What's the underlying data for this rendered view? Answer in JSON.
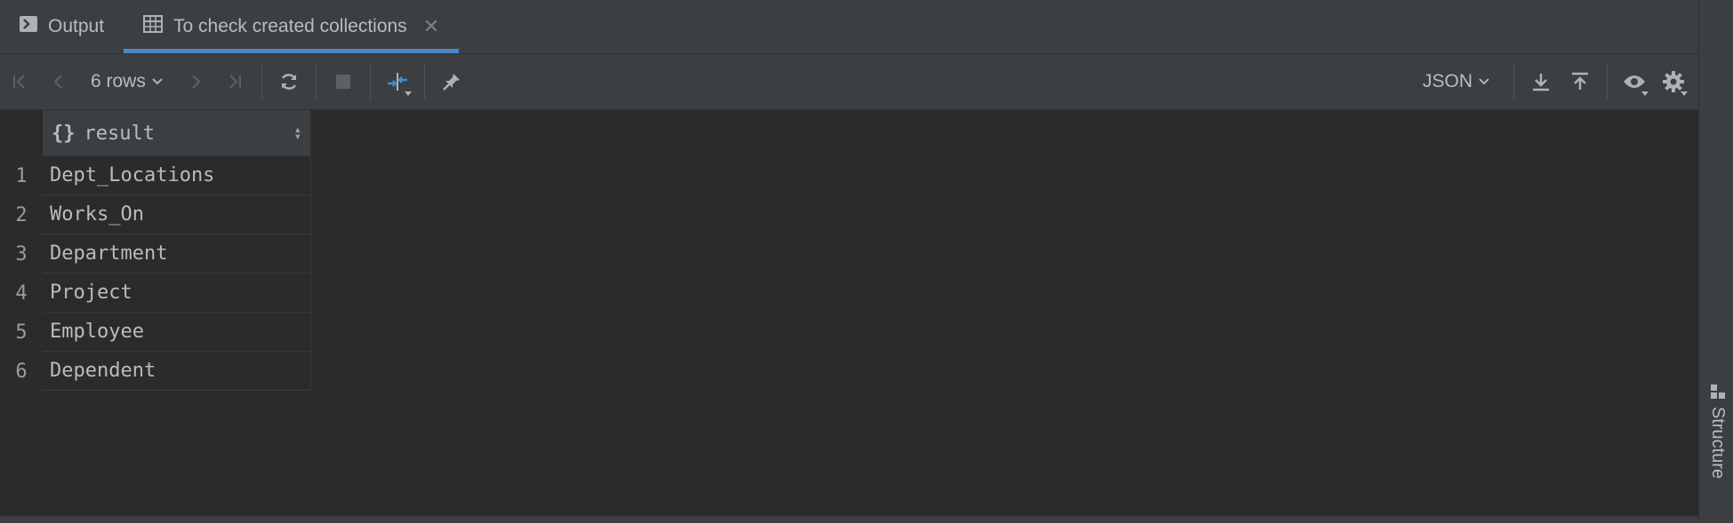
{
  "tabs": [
    {
      "label": "Output",
      "icon": "console-icon",
      "active": false
    },
    {
      "label": "To check created collections",
      "icon": "table-icon",
      "active": true,
      "closable": true
    }
  ],
  "toolbar": {
    "rows_label": "6 rows",
    "format_label": "JSON"
  },
  "grid": {
    "column": {
      "name": "result",
      "icon": "json-object-icon"
    },
    "rows": [
      {
        "num": "1",
        "value": "Dept_Locations"
      },
      {
        "num": "2",
        "value": "Works_On"
      },
      {
        "num": "3",
        "value": "Department"
      },
      {
        "num": "4",
        "value": "Project"
      },
      {
        "num": "5",
        "value": "Employee"
      },
      {
        "num": "6",
        "value": "Dependent"
      }
    ]
  },
  "side_panel": {
    "label": "Structure"
  },
  "colors": {
    "accent": "#4a88c7",
    "background": "#2b2b2b",
    "panel": "#3c3f41"
  }
}
